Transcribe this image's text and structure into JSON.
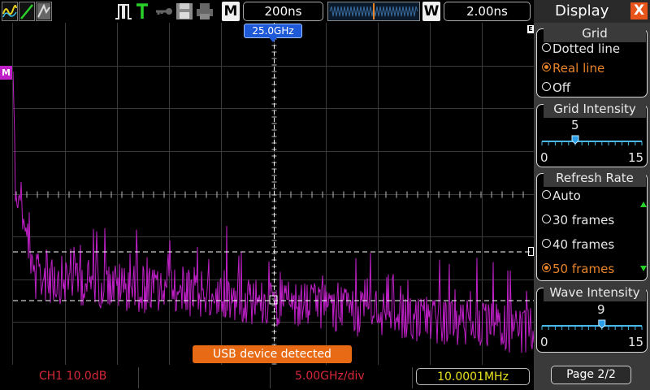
{
  "header": {
    "horizontal_center": "25.0GHz",
    "memory_mode": "M",
    "timebase": "200ns",
    "window_mode": "W",
    "window_timebase": "2.00ns"
  },
  "status": {
    "channel_scale": "CH1 10.0dB",
    "freq_per_div": "5.00GHz/div",
    "frequency": "10.0001MHz",
    "notification": "USB device detected"
  },
  "trace": {
    "channel_marker": "M",
    "color": "#c020c8",
    "accent": "#e8842a"
  },
  "panel": {
    "title": "Display",
    "close_symbol": "X",
    "grid": {
      "title": "Grid",
      "options": [
        "Dotted line",
        "Real line",
        "Off"
      ],
      "selected": "Real line"
    },
    "grid_intensity": {
      "title": "Grid Intensity",
      "value": "5",
      "min": "0",
      "max": "15"
    },
    "refresh_rate": {
      "title": "Refresh Rate",
      "options": [
        "Auto",
        "30 frames",
        "40 frames",
        "50 frames"
      ],
      "selected": "50 frames"
    },
    "wave_intensity": {
      "title": "Wave Intensity",
      "value": "9",
      "min": "0",
      "max": "15"
    },
    "page": "Page 2/2"
  }
}
